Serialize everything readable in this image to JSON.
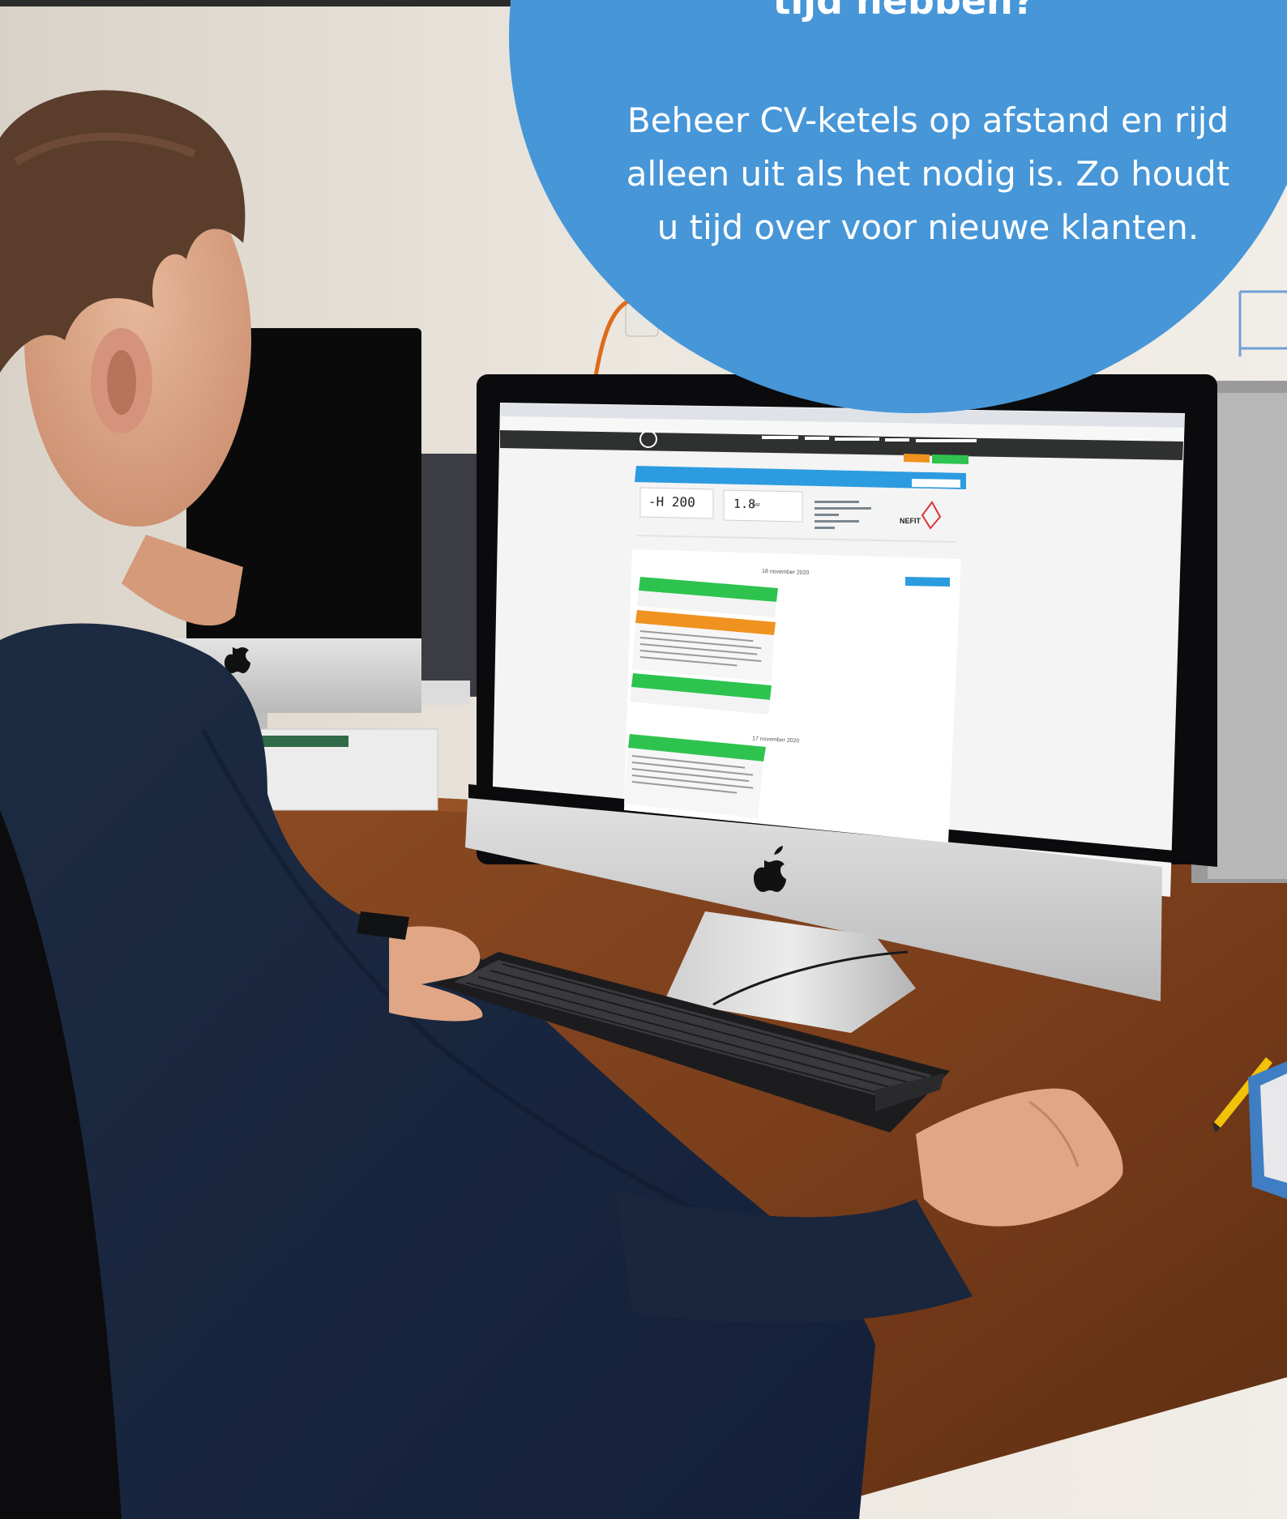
{
  "promo": {
    "heading": "tijd hebben?",
    "body_lines": [
      "Beheer CV-ketels op afstand en rijd",
      "alleen uit als het nodig is. Zo houdt",
      "u tijd over voor nieuwe klanten."
    ],
    "color": "#4696d8"
  },
  "screen": {
    "display_left": "-H 200",
    "display_right": "1.8",
    "display_right_unit": "bar",
    "brand_logo": "NEFIT",
    "dates": [
      "18 november 2020",
      "17 november 2020"
    ],
    "status_colors": {
      "green": "#2ec34f",
      "orange": "#f0921f",
      "blue": "#2d9be0"
    }
  }
}
